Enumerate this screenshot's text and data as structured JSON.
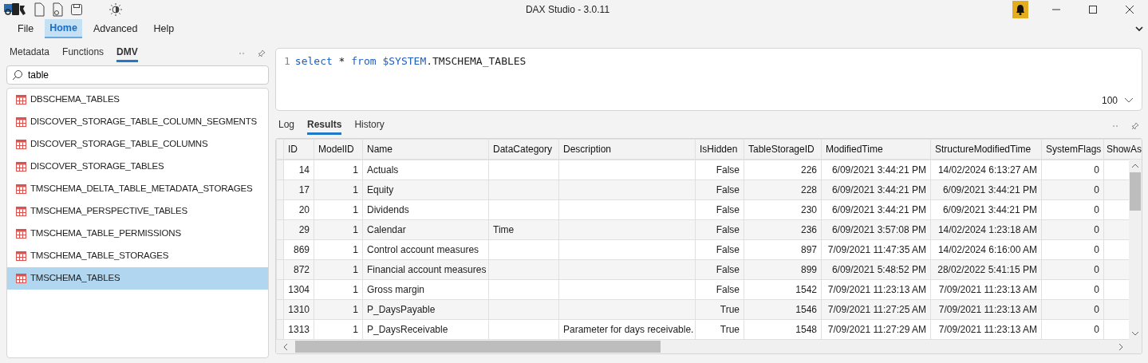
{
  "window": {
    "title": "DAX Studio - 3.0.11"
  },
  "menu": [
    {
      "label": "File",
      "selected": false
    },
    {
      "label": "Home",
      "selected": true
    },
    {
      "label": "Advanced",
      "selected": false
    },
    {
      "label": "Help",
      "selected": false
    }
  ],
  "left_panel": {
    "tabs": [
      {
        "label": "Metadata",
        "selected": false
      },
      {
        "label": "Functions",
        "selected": false
      },
      {
        "label": "DMV",
        "selected": true
      }
    ],
    "search": {
      "value": "table"
    },
    "items": [
      {
        "label": "DBSCHEMA_TABLES",
        "selected": false
      },
      {
        "label": "DISCOVER_STORAGE_TABLE_COLUMN_SEGMENTS",
        "selected": false
      },
      {
        "label": "DISCOVER_STORAGE_TABLE_COLUMNS",
        "selected": false
      },
      {
        "label": "DISCOVER_STORAGE_TABLES",
        "selected": false
      },
      {
        "label": "TMSCHEMA_DELTA_TABLE_METADATA_STORAGES",
        "selected": false
      },
      {
        "label": "TMSCHEMA_PERSPECTIVE_TABLES",
        "selected": false
      },
      {
        "label": "TMSCHEMA_TABLE_PERMISSIONS",
        "selected": false
      },
      {
        "label": "TMSCHEMA_TABLE_STORAGES",
        "selected": false
      },
      {
        "label": "TMSCHEMA_TABLES",
        "selected": true
      }
    ]
  },
  "editor": {
    "line_number": "1",
    "tokens": [
      {
        "text": "select",
        "kind": "keyword"
      },
      {
        "text": " * ",
        "kind": "plain"
      },
      {
        "text": "from",
        "kind": "keyword"
      },
      {
        "text": " $SYSTEM",
        "kind": "keyword"
      },
      {
        "text": ".TMSCHEMA_TABLES",
        "kind": "plain"
      }
    ],
    "row_limit": "100"
  },
  "output_tabs": [
    {
      "label": "Log",
      "selected": false
    },
    {
      "label": "Results",
      "selected": true
    },
    {
      "label": "History",
      "selected": false
    }
  ],
  "results": {
    "columns": [
      {
        "label": "ID",
        "kind": "number"
      },
      {
        "label": "ModelID",
        "kind": "number"
      },
      {
        "label": "Name",
        "kind": "text"
      },
      {
        "label": "DataCategory",
        "kind": "text"
      },
      {
        "label": "Description",
        "kind": "text"
      },
      {
        "label": "IsHidden",
        "kind": "number"
      },
      {
        "label": "TableStorageID",
        "kind": "number"
      },
      {
        "label": "ModifiedTime",
        "kind": "number"
      },
      {
        "label": "StructureModifiedTime",
        "kind": "number"
      },
      {
        "label": "SystemFlags",
        "kind": "number"
      },
      {
        "label": "ShowAs",
        "kind": "text"
      }
    ],
    "rows": [
      [
        "14",
        "1",
        "Actuals",
        null,
        null,
        "False",
        "226",
        "6/09/2021 3:44:21 PM",
        "14/02/2024 6:13:27 AM",
        "0"
      ],
      [
        "17",
        "1",
        "Equity",
        null,
        null,
        "False",
        "228",
        "6/09/2021 3:44:21 PM",
        "6/09/2021 3:44:21 PM",
        "0"
      ],
      [
        "20",
        "1",
        "Dividends",
        null,
        null,
        "False",
        "230",
        "6/09/2021 3:44:21 PM",
        "6/09/2021 3:44:21 PM",
        "0"
      ],
      [
        "29",
        "1",
        "Calendar",
        "Time",
        null,
        "False",
        "236",
        "6/09/2021 3:57:08 PM",
        "14/02/2024 1:23:18 AM",
        "0"
      ],
      [
        "869",
        "1",
        "Control account measures",
        null,
        null,
        "False",
        "897",
        "7/09/2021 11:47:35 AM",
        "14/02/2024 6:16:00 AM",
        "0"
      ],
      [
        "872",
        "1",
        "Financial account measures",
        null,
        null,
        "False",
        "899",
        "6/09/2021 5:48:52 PM",
        "28/02/2022 5:41:15 PM",
        "0"
      ],
      [
        "1304",
        "1",
        "Gross margin",
        null,
        null,
        "False",
        "1542",
        "7/09/2021 11:23:13 AM",
        "7/09/2021 11:23:13 AM",
        "0"
      ],
      [
        "1310",
        "1",
        "P_DaysPayable",
        null,
        null,
        "True",
        "1546",
        "7/09/2021 11:27:25 AM",
        "7/09/2021 11:23:13 AM",
        "0"
      ],
      [
        "1313",
        "1",
        "P_DaysReceivable",
        null,
        "Parameter for days receivable.",
        "True",
        "1548",
        "7/09/2021 11:27:29 AM",
        "7/09/2021 11:23:13 AM",
        "0"
      ]
    ]
  }
}
